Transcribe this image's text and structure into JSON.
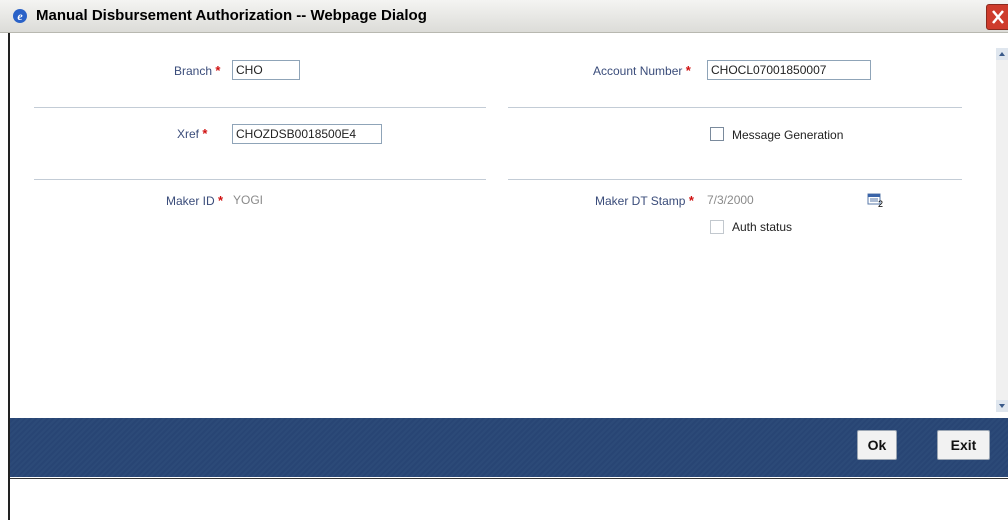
{
  "window": {
    "title": "Manual Disbursement Authorization -- Webpage Dialog"
  },
  "form": {
    "branch": {
      "label": "Branch",
      "value": "CHO"
    },
    "account_number": {
      "label": "Account Number",
      "value": "CHOCL07001850007"
    },
    "xref": {
      "label": "Xref",
      "value": "CHOZDSB0018500E4"
    },
    "message_generation": {
      "label": "Message Generation",
      "checked": false
    },
    "maker_id": {
      "label": "Maker ID",
      "value": "YOGI"
    },
    "maker_dt_stamp": {
      "label": "Maker DT Stamp",
      "value": "7/3/2000"
    },
    "auth_status": {
      "label": "Auth status",
      "checked": false
    },
    "required_marker": "*"
  },
  "buttons": {
    "ok": "Ok",
    "exit": "Exit"
  },
  "icons": {
    "app": "ie-icon",
    "close": "close-icon",
    "calendar": "calendar-icon"
  },
  "colors": {
    "footer": "#2c4a78",
    "label": "#3a4c7a",
    "required": "#d01010",
    "close": "#ce3b2b"
  }
}
